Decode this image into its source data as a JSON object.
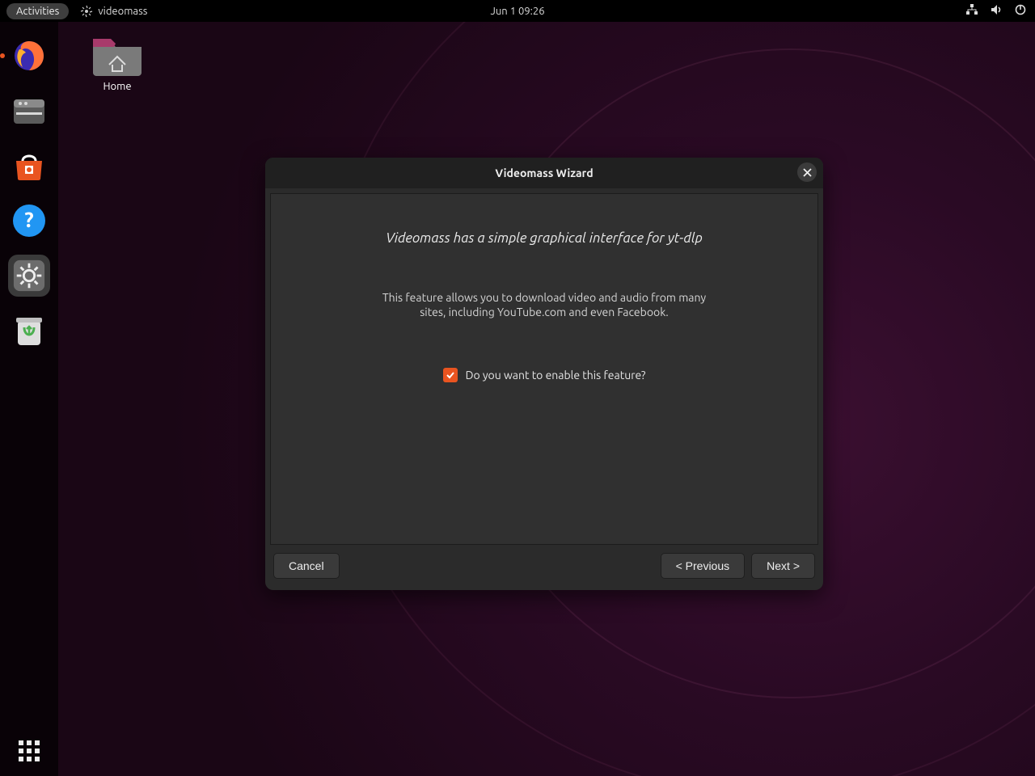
{
  "topbar": {
    "activities": "Activities",
    "app_name": "videomass",
    "clock": "Jun 1  09:26"
  },
  "desktop": {
    "home_label": "Home"
  },
  "dialog": {
    "title": "Videomass Wizard",
    "headline": "Videomass has a simple graphical interface for yt-dlp",
    "description": "This feature allows you to download video and audio from many sites, including YouTube.com and even Facebook.",
    "checkbox_label": "Do you want to enable this feature?",
    "checkbox_checked": true,
    "buttons": {
      "cancel": "Cancel",
      "previous": "< Previous",
      "next": "Next >"
    }
  },
  "dock": {
    "items": [
      "firefox",
      "files",
      "software",
      "help",
      "settings",
      "trash"
    ]
  }
}
